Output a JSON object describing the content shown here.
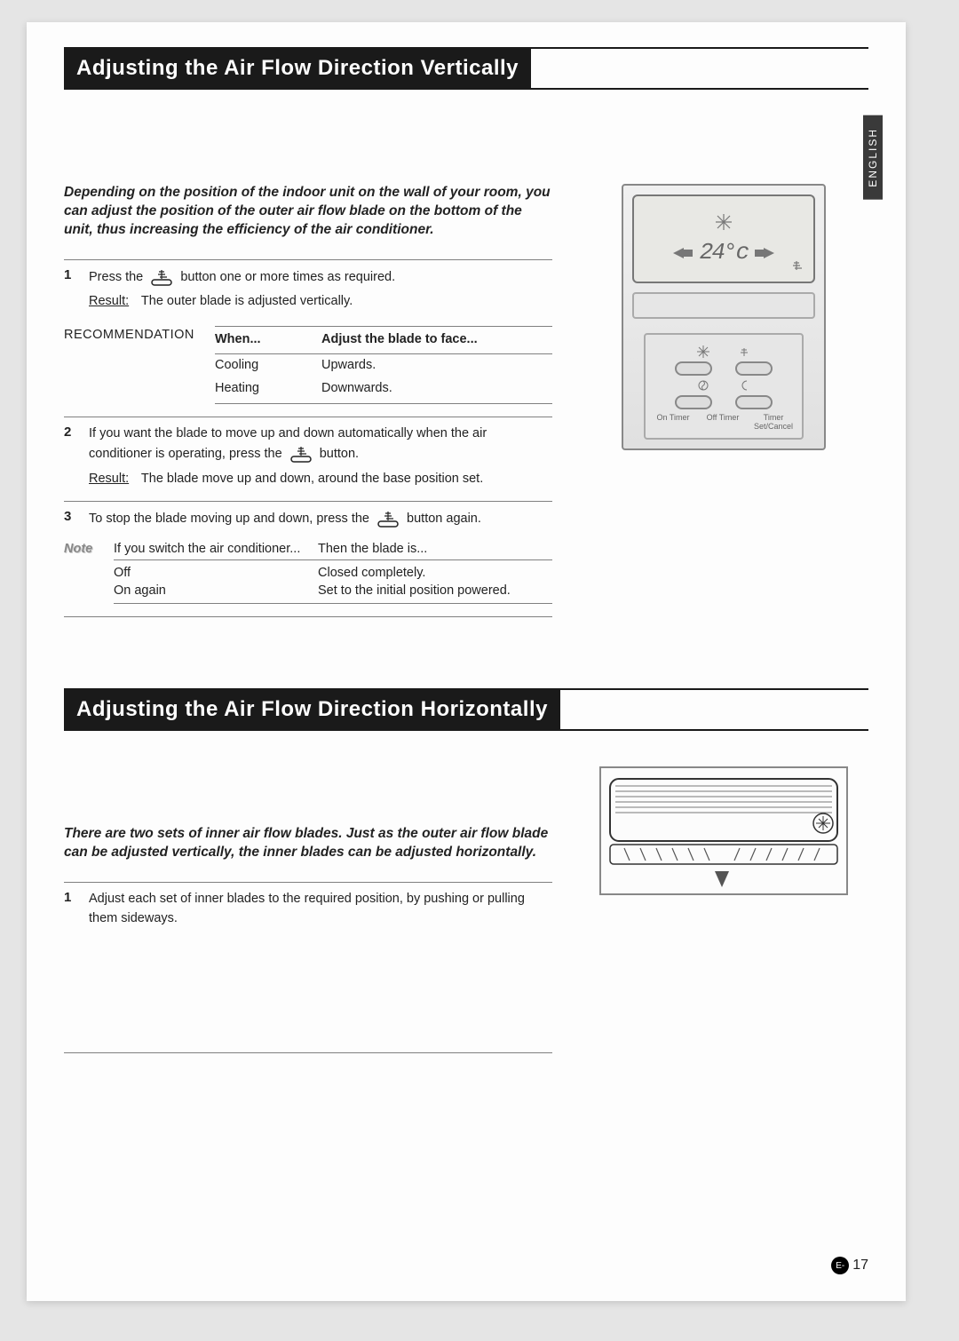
{
  "lang_tab": "ENGLISH",
  "section1": {
    "title": "Adjusting the Air Flow Direction Vertically",
    "intro": "Depending on the position of the indoor unit on the wall of your room, you can adjust the position of the outer air flow blade on the bottom of the unit, thus increasing the efficiency of the air conditioner.",
    "step1": {
      "num": "1",
      "text_a": "Press the",
      "text_b": "button one or more times as required.",
      "result_label": "Result:",
      "result_text": "The outer blade is adjusted vertically."
    },
    "recommendation": {
      "label": "RECOMMENDATION",
      "head_when": "When...",
      "head_adjust": "Adjust the blade to face...",
      "rows": [
        {
          "when": "Cooling",
          "adjust": "Upwards."
        },
        {
          "when": "Heating",
          "adjust": "Downwards."
        }
      ]
    },
    "step2": {
      "num": "2",
      "text_a": "If you want the blade to move up and down automatically when the air conditioner is operating, press the",
      "text_b": "button.",
      "result_label": "Result:",
      "result_text": "The blade move up and down, around the base position set."
    },
    "step3": {
      "num": "3",
      "text_a": "To stop the blade moving up and down, press the",
      "text_b": "button again."
    },
    "note": {
      "label": "Note",
      "head_if": "If you switch the air conditioner...",
      "head_then": "Then the blade is...",
      "rows": [
        {
          "if": "Off",
          "then": "Closed completely."
        },
        {
          "if": "On again",
          "then": "Set to the initial position powered."
        }
      ]
    }
  },
  "remote": {
    "mode_icon": "snowflake",
    "temp": "24°c",
    "btn_labels": [
      "On Timer",
      "Off Timer",
      "Timer Set/Cancel"
    ]
  },
  "section2": {
    "title": "Adjusting the Air Flow Direction Horizontally",
    "intro": "There are two sets of inner air flow blades. Just as the outer air flow blade can be adjusted vertically, the inner blades can be adjusted horizontally.",
    "step1": {
      "num": "1",
      "text": "Adjust each set of inner blades to the required position, by pushing or pulling them sideways."
    }
  },
  "page_num": {
    "prefix": "E-",
    "num": "17"
  }
}
